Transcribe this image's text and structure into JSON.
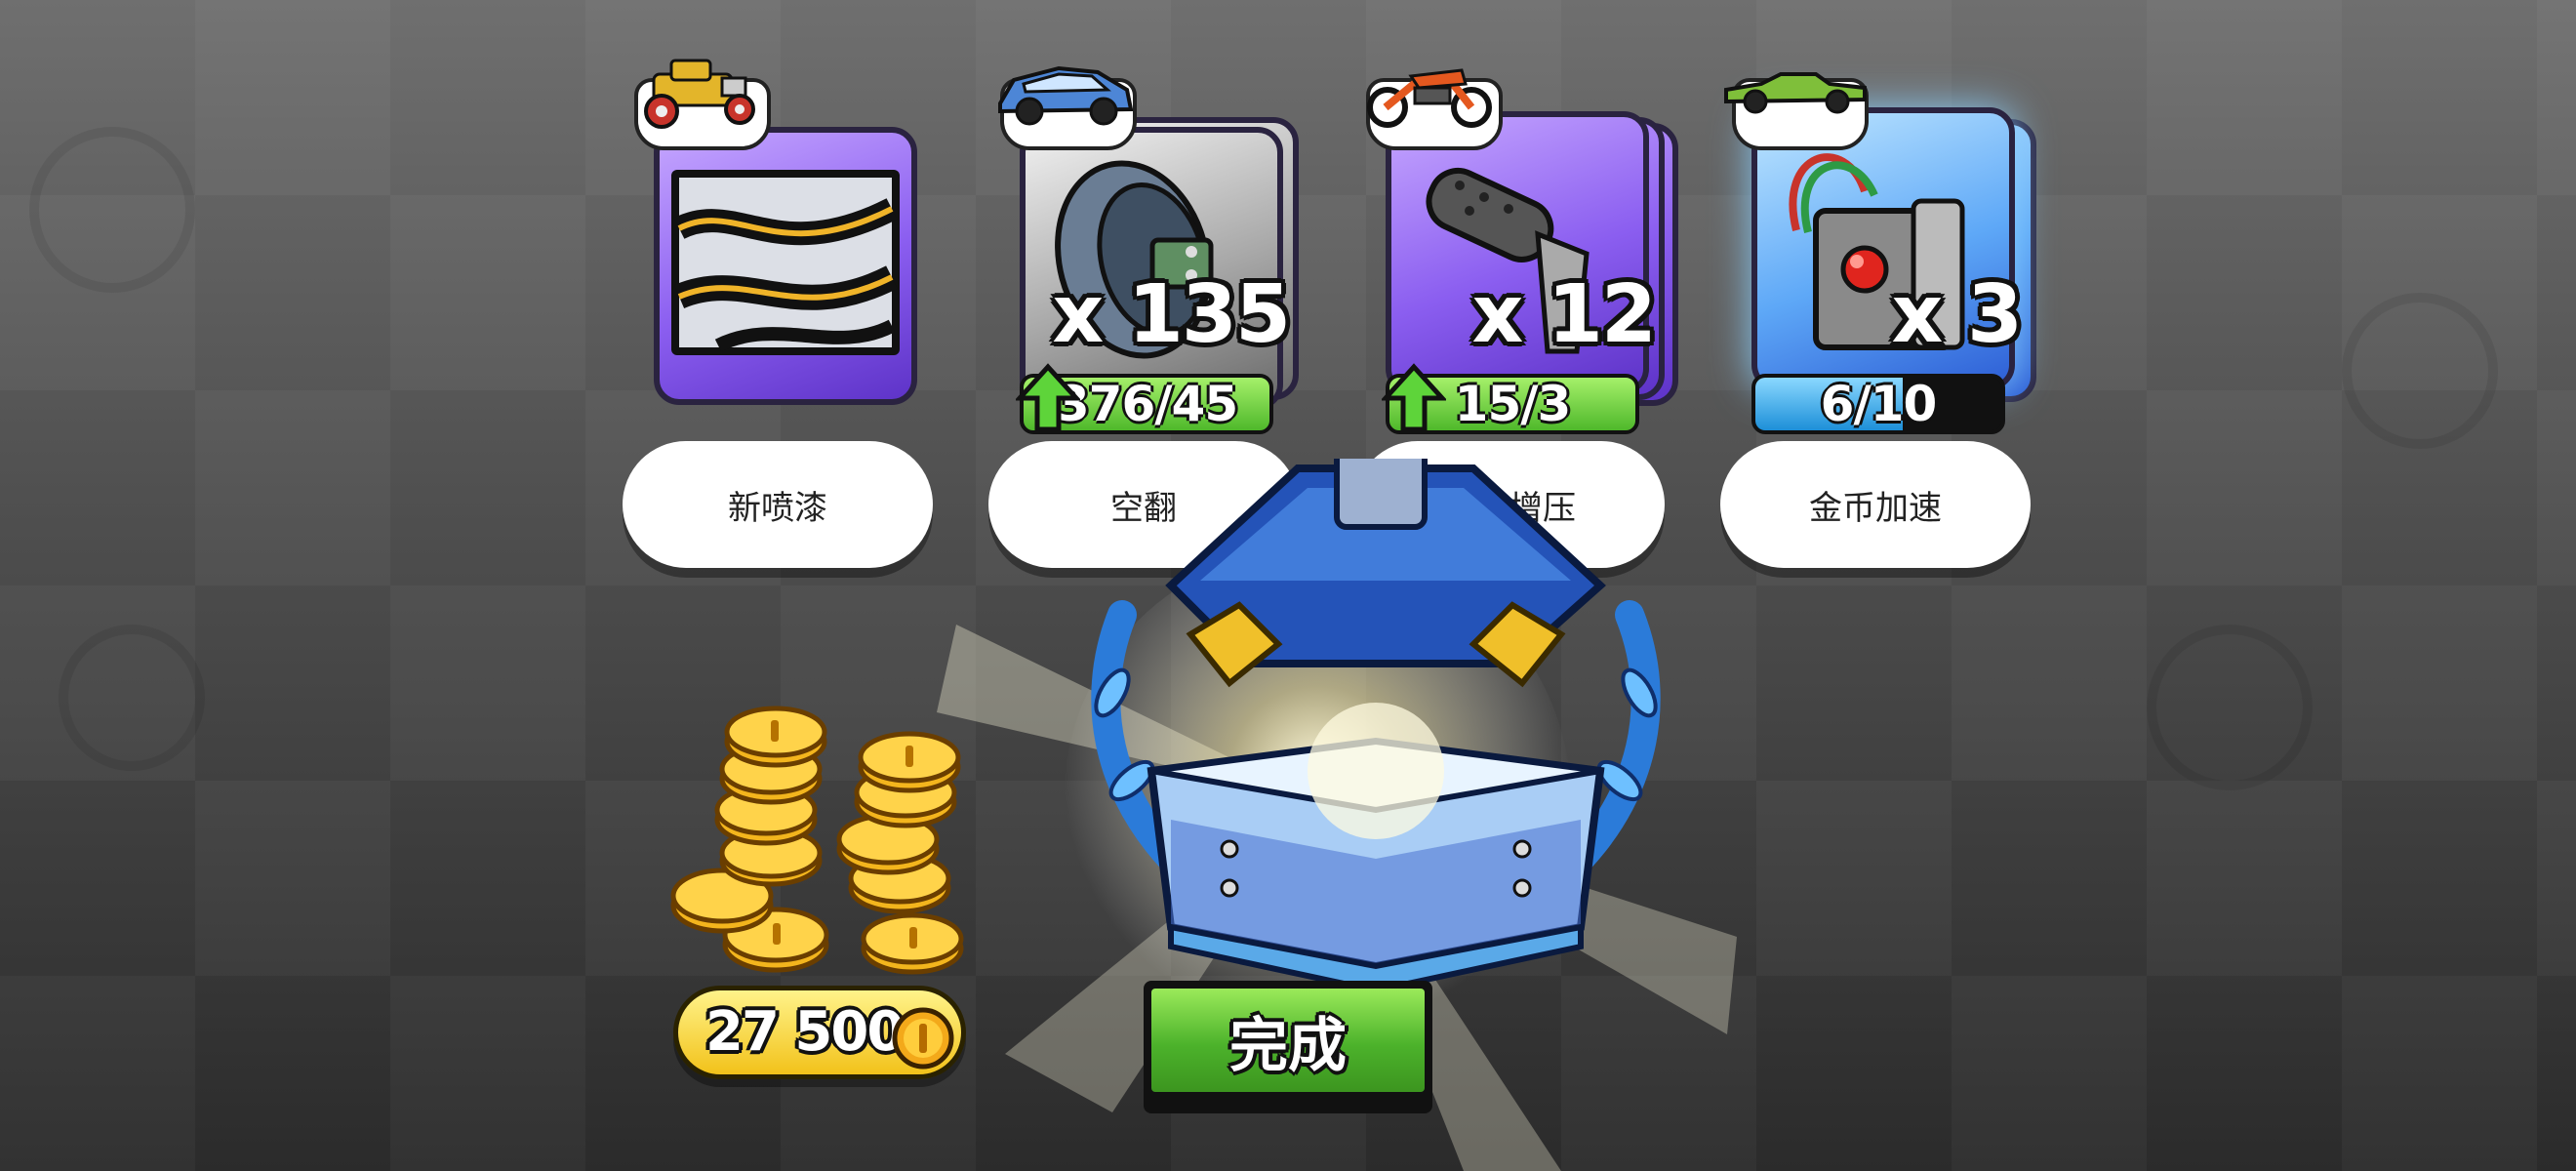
{
  "rewards": [
    {
      "name": "新喷漆",
      "vehicle_icon": "hot-rod-icon",
      "item_icon": "paint-job-icon"
    },
    {
      "name": "空翻",
      "vehicle_icon": "hatchback-car-icon",
      "item_icon": "tire-part-icon",
      "count": "x 135",
      "progress": "376/45"
    },
    {
      "name": "涡轮增压",
      "vehicle_icon": "dirt-bike-icon",
      "item_icon": "exhaust-pipe-icon",
      "count": "x 12",
      "progress": "15/3"
    },
    {
      "name": "金币加速",
      "vehicle_icon": "lowrider-car-icon",
      "item_icon": "control-box-icon",
      "count": "x 3",
      "progress": "6/10",
      "progress_fraction": 0.6
    }
  ],
  "coins": {
    "amount": "27 500",
    "icon": "coin-icon"
  },
  "done_button": {
    "label": "完成"
  },
  "chest": {
    "icon": "open-chest-icon"
  },
  "colors": {
    "green": "#4cb22b",
    "purple": "#8b5ef0",
    "blue": "#5ea8f7",
    "gold": "#f2c21a"
  }
}
